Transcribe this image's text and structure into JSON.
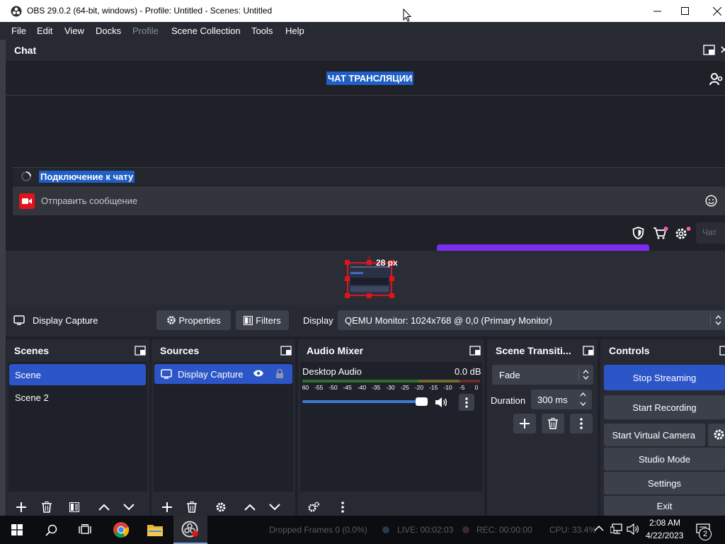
{
  "window": {
    "title": "OBS 29.0.2 (64-bit, windows) - Profile: Untitled - Scenes: Untitled"
  },
  "menu": [
    "File",
    "Edit",
    "View",
    "Docks",
    "Profile",
    "Scene Collection",
    "Tools",
    "Help"
  ],
  "chat": {
    "dock_title": "Chat",
    "header": "ЧАТ ТРАНСЛЯЦИИ",
    "connecting": "Подключение к чату",
    "message_placeholder": "Отправить сообщение",
    "chat_button": "Чат"
  },
  "preview": {
    "size_label": "28 px"
  },
  "source_toolbar": {
    "source_name": "Display Capture",
    "properties": "Properties",
    "filters": "Filters",
    "display_label": "Display",
    "display_value": "QEMU Monitor: 1024x768 @ 0,0 (Primary Monitor)"
  },
  "scenes": {
    "title": "Scenes",
    "items": [
      "Scene",
      "Scene 2"
    ],
    "selected": "Scene"
  },
  "sources": {
    "title": "Sources",
    "items": [
      "Display Capture"
    ]
  },
  "audio_mixer": {
    "title": "Audio Mixer",
    "channel": "Desktop Audio",
    "level": "0.0 dB",
    "scale": [
      "-60",
      "-55",
      "-50",
      "-45",
      "-40",
      "-35",
      "-30",
      "-25",
      "-20",
      "-15",
      "-10",
      "-5",
      "0"
    ],
    "volume_fraction": 0.98
  },
  "transitions": {
    "title": "Scene Transiti...",
    "selected": "Fade",
    "duration_label": "Duration",
    "duration_value": "300 ms"
  },
  "controls": {
    "title": "Controls",
    "stop_streaming": "Stop Streaming",
    "start_recording": "Start Recording",
    "start_virtual_camera": "Start Virtual Camera",
    "studio_mode": "Studio Mode",
    "settings": "Settings",
    "exit": "Exit"
  },
  "status_bar": {
    "dropped_frames": "Dropped Frames 0 (0.0%)",
    "live": "LIVE: 00:02:03",
    "rec": "REC: 00:00:00",
    "cpu": "CPU: 33.4%"
  },
  "taskbar": {
    "time": "2:08 AM",
    "date": "4/22/2023",
    "notification_count": "2"
  },
  "colors": {
    "accent": "#2c55c8",
    "recording_red": "#e0141a",
    "purple_bar": "#7a2cf0"
  }
}
